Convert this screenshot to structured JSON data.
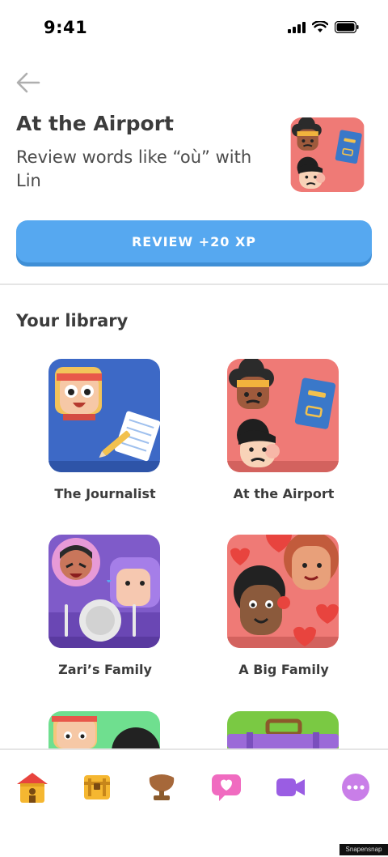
{
  "status_bar": {
    "time": "9:41"
  },
  "hero": {
    "title": "At the Airport",
    "subtitle": "Review words like “où” with Lin",
    "review_button": "REVIEW +20 XP"
  },
  "library": {
    "title": "Your library",
    "items": [
      {
        "label": "The Journalist"
      },
      {
        "label": "At the Airport"
      },
      {
        "label": "Zari’s Family"
      },
      {
        "label": "A Big Family"
      }
    ]
  },
  "bottom_nav": {
    "items": [
      {
        "icon": "home-icon"
      },
      {
        "icon": "treasure-chest-icon"
      },
      {
        "icon": "trophy-icon"
      },
      {
        "icon": "heart-chat-icon"
      },
      {
        "icon": "video-camera-icon"
      },
      {
        "icon": "more-icon"
      }
    ]
  },
  "footer": {
    "credit": "Snapensnap"
  },
  "colors": {
    "accent": "#56a8f0",
    "accent_shadow": "#3f8fd6",
    "divider": "#e5e5e5"
  }
}
